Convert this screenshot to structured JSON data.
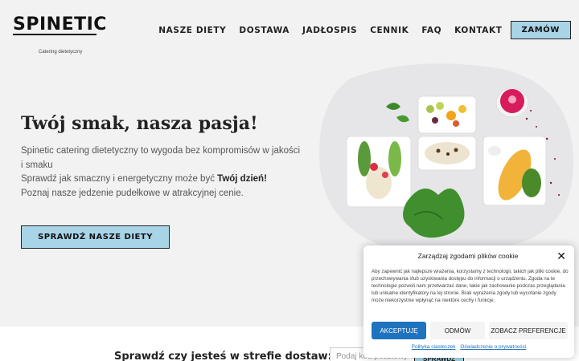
{
  "header": {
    "logo": "SPINETIC",
    "logo_sub": "Catering dietetyczny",
    "nav": [
      "NASZE DIETY",
      "DOSTAWA",
      "JADŁOSPIS",
      "CENNIK",
      "FAQ",
      "KONTAKT"
    ],
    "order_button": "ZAMÓW"
  },
  "hero": {
    "title": "Twój smak, nasza pasja!",
    "line1": "Spinetic catering dietetyczny to wygoda bez kompromisów w jakości i smaku",
    "line2_prefix": "Sprawdź jak smaczny i energetyczny może być ",
    "line2_bold": "Twój dzień!",
    "line3": "Poznaj nasze jedzenie pudełkowe w atrakcyjnej cenie.",
    "cta": "SPRAWDŹ NASZE DIETY"
  },
  "delivery": {
    "label": "Sprawdź czy jesteś w strefie dostaw:",
    "placeholder": "Podaj kod pocztowy",
    "button": "SPRAWDŹ"
  },
  "cookie": {
    "title": "Zarządzaj zgodami plików cookie",
    "text": "Aby zapewnić jak najlepsze wrażenia, korzystamy z technologii, takich jak pliki cookie, do przechowywania i/lub uzyskiwania dostępu do informacji o urządzeniu. Zgoda na te technologie pozwoli nam przetwarzać dane, takie jak zachowanie podczas przeglądania lub unikalne identyfikatory na tej stronie. Brak wyrażenia zgody lub wycofanie zgody może niekorzystnie wpłynąć na niektóre cechy i funkcje.",
    "accept": "AKCEPTUJĘ",
    "deny": "ODMÓW",
    "prefs": "ZOBACZ PREFERENCJE",
    "link1": "Polityka ciasteczek",
    "link2": "Oświadczenie o prywatności"
  }
}
